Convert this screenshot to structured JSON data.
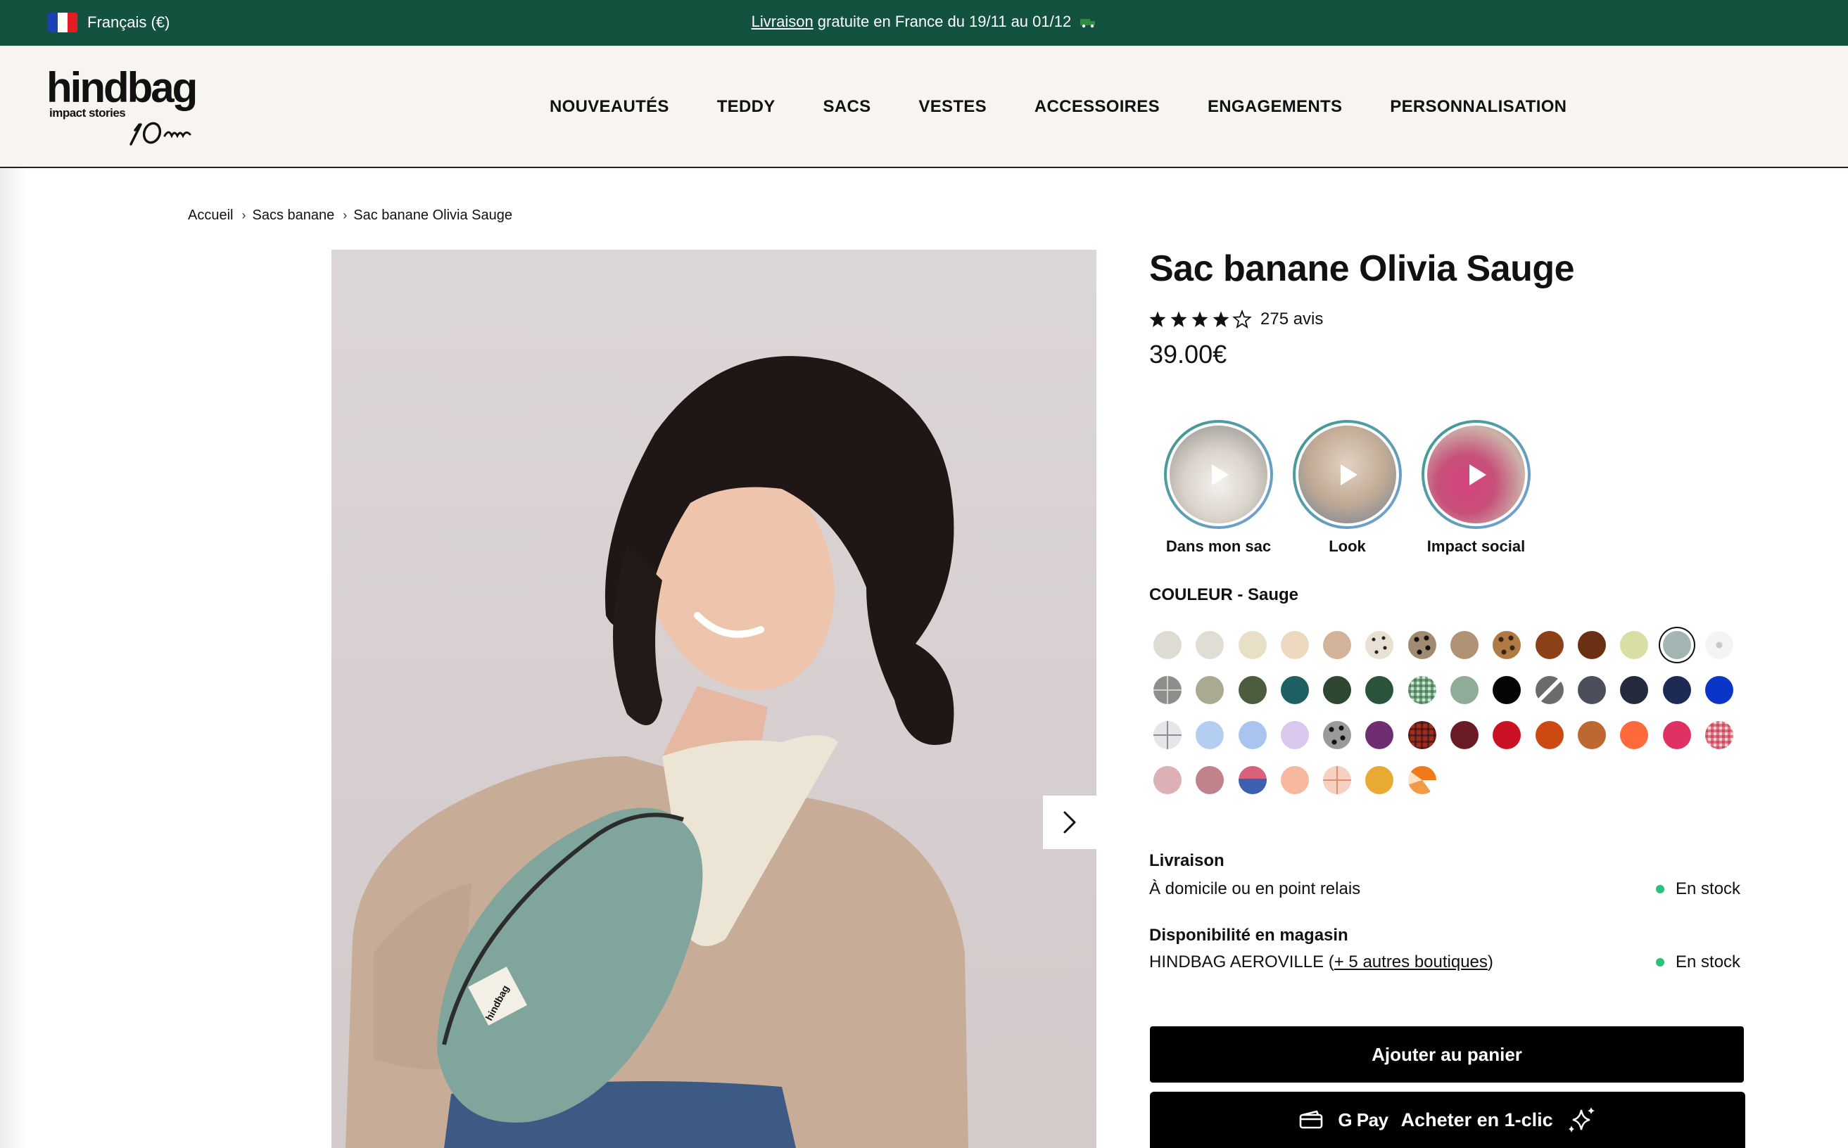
{
  "topbar": {
    "language": "Français (€)",
    "announcement_link": "Livraison",
    "announcement_text": " gratuite en France du 19/11 au 01/12"
  },
  "header": {
    "logo": {
      "brand": "hindbag",
      "tagline": "impact stories",
      "anniversary": "10 ans"
    },
    "nav": [
      "NOUVEAUTÉS",
      "TEDDY",
      "SACS",
      "VESTES",
      "ACCESSOIRES",
      "ENGAGEMENTS",
      "PERSONNALISATION"
    ]
  },
  "breadcrumb": [
    "Accueil",
    "Sacs banane",
    "Sac banane Olivia Sauge"
  ],
  "product": {
    "title": "Sac banane Olivia Sauge",
    "rating": 4.5,
    "reviews": "275 avis",
    "price": "39.00€"
  },
  "stories": [
    {
      "label": "Dans mon sac",
      "icon": "play-icon"
    },
    {
      "label": "Look",
      "icon": "play-icon"
    },
    {
      "label": "Impact social",
      "icon": "play-icon"
    }
  ],
  "color": {
    "heading": "COULEUR - Sauge",
    "selected_index": 12,
    "swatches": [
      [
        "#dedbd3",
        "#e0ddd4",
        "#e7dfc6",
        "#eed8bf",
        "#d2b299",
        "leopard-light",
        "leopard-dark",
        "#b29275",
        "leopard-brown",
        "#8b4018",
        "#6b3014",
        "#d8dea4",
        "#a3b5b3",
        "heart-pattern"
      ],
      [
        "cross-gray",
        "#a9aa91",
        "#4b5c3f",
        "#1e5f63",
        "#2f4632",
        "#29533a",
        "gingham-green",
        "#90ab97",
        "#050505",
        "slash-gray",
        "#4a4f5b",
        "#252a3f",
        "#1d2a55",
        "#0b35c6"
      ],
      [
        "cross-light",
        "#b4cef2",
        "#a9c4ef",
        "#dac8ef",
        "leopard-gray",
        "#6e2e71",
        "tartan-red",
        "#6a1b25",
        "#cc1024",
        "#cc4a12",
        "#bd6830",
        "#ff6a3d",
        "#df3162",
        "gingham-red"
      ],
      [
        "#dcb0b4",
        "#c0838c",
        "stripe-pink-blue",
        "#f6b9a0",
        "cross-peach",
        "#e9aa33",
        "patch-orange"
      ]
    ]
  },
  "delivery": {
    "heading": "Livraison",
    "detail": "À domicile ou en point relais",
    "status": "En stock"
  },
  "store": {
    "heading": "Disponibilité en magasin",
    "store_name": "HINDBAG AEROVILLE (",
    "others_link": "+ 5 autres boutiques",
    "closing": ")",
    "status": "En stock"
  },
  "actions": {
    "add_to_cart": "Ajouter au panier",
    "gpay": "G Pay",
    "buy_one_click": "Acheter en 1-clic"
  }
}
